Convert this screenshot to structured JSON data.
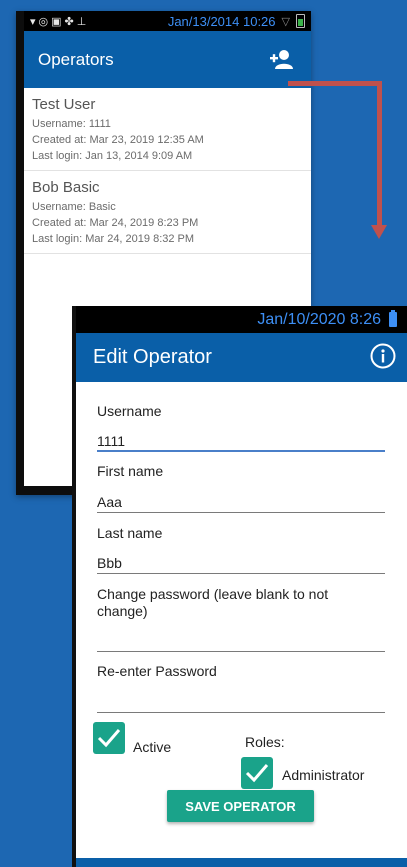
{
  "colors": {
    "background": "#1d67b2",
    "appbar": "#0a5fa8",
    "accent_teal": "#1aa38a",
    "status_time": "#3d8ff5",
    "arrow": "#c0514d"
  },
  "back_screen": {
    "status_bar": {
      "icons": [
        "wifi-icon",
        "sync-icon",
        "image-icon",
        "gps-icon",
        "usb-icon",
        "signal-icon",
        "battery-icon"
      ],
      "time": "Jan/13/2014 10:26"
    },
    "title": "Operators",
    "add_icon": "add-person-icon",
    "operators": [
      {
        "name": "Test User",
        "username": "Username: 1111",
        "created": "Created at: Mar 23, 2019 12:35 AM",
        "last_login": "Last login: Jan 13, 2014 9:09 AM"
      },
      {
        "name": "Bob Basic",
        "username": "Username: Basic",
        "created": "Created at: Mar 24, 2019 8:23 PM",
        "last_login": "Last login: Mar 24, 2019 8:32 PM"
      }
    ]
  },
  "front_screen": {
    "status_bar": {
      "time": "Jan/10/2020 8:26",
      "battery_icon": "battery-icon"
    },
    "title": "Edit Operator",
    "info_icon": "info-icon",
    "form": {
      "username_label": "Username",
      "username_value": "1111",
      "first_name_label": "First name",
      "first_name_value": "Aaa",
      "last_name_label": "Last name",
      "last_name_value": "Bbb",
      "password_label": "Change password (leave blank to not change)",
      "password_value": "",
      "reenter_label": "Re-enter Password",
      "reenter_value": "",
      "active_label": "Active",
      "active_checked": true,
      "roles_label": "Roles:",
      "admin_label": "Administrator",
      "admin_checked": true,
      "save_label": "SAVE OPERATOR"
    }
  }
}
